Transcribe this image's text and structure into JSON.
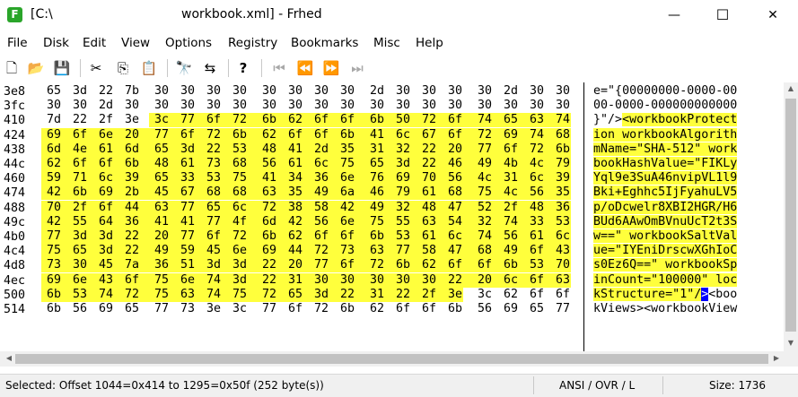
{
  "window": {
    "path": "[C:\\",
    "file_title": "workbook.xml] - Frhed",
    "app_icon_letter": "F",
    "minimize_glyph": "—",
    "maximize_glyph": "☐",
    "close_glyph": "✕"
  },
  "menu": [
    "File",
    "Disk",
    "Edit",
    "View",
    "Options",
    "Registry",
    "Bookmarks",
    "Misc",
    "Help"
  ],
  "toolbar": [
    {
      "name": "new-file-icon",
      "glyph": "🗋"
    },
    {
      "name": "open-folder-icon",
      "glyph": "📂"
    },
    {
      "name": "save-icon",
      "glyph": "💾"
    },
    {
      "name": "cut-icon",
      "glyph": "✂"
    },
    {
      "name": "copy-icon",
      "glyph": "⎘"
    },
    {
      "name": "paste-icon",
      "glyph": "📋"
    },
    {
      "name": "find-icon",
      "glyph": "🔭"
    },
    {
      "name": "replace-icon",
      "glyph": "⇆"
    },
    {
      "name": "help-icon",
      "glyph": "?"
    },
    {
      "name": "go-first-icon",
      "glyph": "⏮"
    },
    {
      "name": "go-previous-icon",
      "glyph": "⏪"
    },
    {
      "name": "go-next-icon",
      "glyph": "⏩"
    },
    {
      "name": "go-last-icon",
      "glyph": "⏭"
    }
  ],
  "hex": {
    "selection": {
      "start": 1044,
      "end": 1295
    },
    "rows": [
      {
        "offset": "3e8",
        "dec": 1000,
        "bytes": [
          "65",
          "3d",
          "22",
          "7b",
          "30",
          "30",
          "30",
          "30",
          "30",
          "30",
          "30",
          "30",
          "2d",
          "30",
          "30",
          "30",
          "30",
          "2d",
          "30",
          "30"
        ],
        "text": "e=\"{00000000-0000-00"
      },
      {
        "offset": "3fc",
        "dec": 1020,
        "bytes": [
          "30",
          "30",
          "2d",
          "30",
          "30",
          "30",
          "30",
          "30",
          "30",
          "30",
          "30",
          "30",
          "30",
          "30",
          "30",
          "30",
          "30",
          "30",
          "30",
          "30"
        ],
        "text": "00-0000-000000000000"
      },
      {
        "offset": "410",
        "dec": 1040,
        "bytes": [
          "7d",
          "22",
          "2f",
          "3e",
          "3c",
          "77",
          "6f",
          "72",
          "6b",
          "62",
          "6f",
          "6f",
          "6b",
          "50",
          "72",
          "6f",
          "74",
          "65",
          "63",
          "74"
        ],
        "text": "}\"/><workbookProtect"
      },
      {
        "offset": "424",
        "dec": 1060,
        "bytes": [
          "69",
          "6f",
          "6e",
          "20",
          "77",
          "6f",
          "72",
          "6b",
          "62",
          "6f",
          "6f",
          "6b",
          "41",
          "6c",
          "67",
          "6f",
          "72",
          "69",
          "74",
          "68"
        ],
        "text": "ion workbookAlgorith"
      },
      {
        "offset": "438",
        "dec": 1080,
        "bytes": [
          "6d",
          "4e",
          "61",
          "6d",
          "65",
          "3d",
          "22",
          "53",
          "48",
          "41",
          "2d",
          "35",
          "31",
          "32",
          "22",
          "20",
          "77",
          "6f",
          "72",
          "6b"
        ],
        "text": "mName=\"SHA-512\" work"
      },
      {
        "offset": "44c",
        "dec": 1100,
        "bytes": [
          "62",
          "6f",
          "6f",
          "6b",
          "48",
          "61",
          "73",
          "68",
          "56",
          "61",
          "6c",
          "75",
          "65",
          "3d",
          "22",
          "46",
          "49",
          "4b",
          "4c",
          "79"
        ],
        "text": "bookHashValue=\"FIKLy"
      },
      {
        "offset": "460",
        "dec": 1120,
        "bytes": [
          "59",
          "71",
          "6c",
          "39",
          "65",
          "33",
          "53",
          "75",
          "41",
          "34",
          "36",
          "6e",
          "76",
          "69",
          "70",
          "56",
          "4c",
          "31",
          "6c",
          "39"
        ],
        "text": "Yql9e3SuA46nvipVL1l9"
      },
      {
        "offset": "474",
        "dec": 1140,
        "bytes": [
          "42",
          "6b",
          "69",
          "2b",
          "45",
          "67",
          "68",
          "68",
          "63",
          "35",
          "49",
          "6a",
          "46",
          "79",
          "61",
          "68",
          "75",
          "4c",
          "56",
          "35"
        ],
        "text": "Bki+Eghhc5IjFyahuLV5"
      },
      {
        "offset": "488",
        "dec": 1160,
        "bytes": [
          "70",
          "2f",
          "6f",
          "44",
          "63",
          "77",
          "65",
          "6c",
          "72",
          "38",
          "58",
          "42",
          "49",
          "32",
          "48",
          "47",
          "52",
          "2f",
          "48",
          "36"
        ],
        "text": "p/oDcwelr8XBI2HGR/H6"
      },
      {
        "offset": "49c",
        "dec": 1180,
        "bytes": [
          "42",
          "55",
          "64",
          "36",
          "41",
          "41",
          "77",
          "4f",
          "6d",
          "42",
          "56",
          "6e",
          "75",
          "55",
          "63",
          "54",
          "32",
          "74",
          "33",
          "53"
        ],
        "text": "BUd6AAwOmBVnuUcT2t3S"
      },
      {
        "offset": "4b0",
        "dec": 1200,
        "bytes": [
          "77",
          "3d",
          "3d",
          "22",
          "20",
          "77",
          "6f",
          "72",
          "6b",
          "62",
          "6f",
          "6f",
          "6b",
          "53",
          "61",
          "6c",
          "74",
          "56",
          "61",
          "6c"
        ],
        "text": "w==\" workbookSaltVal"
      },
      {
        "offset": "4c4",
        "dec": 1220,
        "bytes": [
          "75",
          "65",
          "3d",
          "22",
          "49",
          "59",
          "45",
          "6e",
          "69",
          "44",
          "72",
          "73",
          "63",
          "77",
          "58",
          "47",
          "68",
          "49",
          "6f",
          "43"
        ],
        "text": "ue=\"IYEniDrscwXGhIoC"
      },
      {
        "offset": "4d8",
        "dec": 1240,
        "bytes": [
          "73",
          "30",
          "45",
          "7a",
          "36",
          "51",
          "3d",
          "3d",
          "22",
          "20",
          "77",
          "6f",
          "72",
          "6b",
          "62",
          "6f",
          "6f",
          "6b",
          "53",
          "70"
        ],
        "text": "s0Ez6Q==\" workbookSp"
      },
      {
        "offset": "4ec",
        "dec": 1260,
        "bytes": [
          "69",
          "6e",
          "43",
          "6f",
          "75",
          "6e",
          "74",
          "3d",
          "22",
          "31",
          "30",
          "30",
          "30",
          "30",
          "30",
          "22",
          "20",
          "6c",
          "6f",
          "63"
        ],
        "text": "inCount=\"100000\" loc"
      },
      {
        "offset": "500",
        "dec": 1280,
        "bytes": [
          "6b",
          "53",
          "74",
          "72",
          "75",
          "63",
          "74",
          "75",
          "72",
          "65",
          "3d",
          "22",
          "31",
          "22",
          "2f",
          "3e",
          "3c",
          "62",
          "6f",
          "6f"
        ],
        "text": "kStructure=\"1\"/><boo"
      },
      {
        "offset": "514",
        "dec": 1300,
        "bytes": [
          "6b",
          "56",
          "69",
          "65",
          "77",
          "73",
          "3e",
          "3c",
          "77",
          "6f",
          "72",
          "6b",
          "62",
          "6f",
          "6f",
          "6b",
          "56",
          "69",
          "65",
          "77"
        ],
        "text": "kViews><workbookView"
      }
    ]
  },
  "status": {
    "selection": "Selected: Offset 1044=0x414 to 1295=0x50f (252 byte(s))",
    "mode": "ANSI / OVR / L",
    "size": "Size: 1736"
  },
  "colors": {
    "selection": "#ffff3c",
    "cursor": "#0000ff"
  }
}
